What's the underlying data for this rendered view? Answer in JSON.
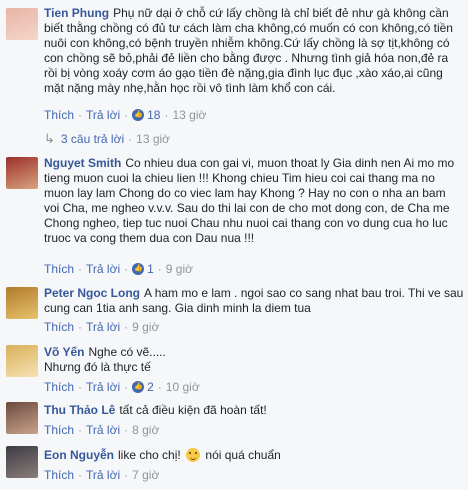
{
  "comments": [
    {
      "author": "Tien Phung",
      "text": "Phụ nữ dại ở chỗ cứ lấy chồng là chỉ biết đẻ như gà không cần biết thằng chồng có đủ tư cách làm cha không,có muốn có con không,có tiền nuôi con không,có bệnh truyền nhiễm không.Cứ lấy chồng là sợ tịt,không có con chồng sẽ bỏ,phải đẻ liền cho bằng được . Nhưng tình giả hóa non,đẻ ra rồi bị vòng xoáy cơm áo gạo tiền đè nặng,gia đình lục đục ,xào xáo,ai cũng mặt nặng mày nhẹ,hằn học rồi vô tình làm khổ con cái.",
      "like": "Thích",
      "reply": "Trả lời",
      "likes": "18",
      "time": "13 giờ",
      "replies": "3 câu trả lời",
      "avatar_colors": [
        "#e8b3a6",
        "#f3d7c9"
      ]
    },
    {
      "author": "Nguyet Smith",
      "text": "Co nhieu dua con gai vi, muon thoat ly Gia dinh nen Ai mo mo tieng muon cuoi la chieu lien !!! Khong chieu Tim hieu coi cai thang ma no muon lay lam Chong do co viec lam hay Khong ? Hay no con o nha an bam voi Cha, me ngheo v.v.v. Sau do thi lai con de cho mot dong con, de Cha me Chong ngheo, tiep tuc nuoi Chau nhu nuoi cai thang con vo dung cua ho luc truoc va cong them dua con Dau nua !!!",
      "like": "Thích",
      "reply": "Trả lời",
      "likes": "1",
      "time": "9 giờ",
      "avatar_colors": [
        "#9c2f2a",
        "#d8a47f"
      ]
    },
    {
      "author": "Peter Ngoc Long",
      "text": "A ham mo e lam . ngoi sao co sang nhat bau troi. Thi ve sau cung can 1tia anh sang. Gia dinh minh la diem tua",
      "like": "Thích",
      "reply": "Trả lời",
      "time": "9 giờ",
      "avatar_colors": [
        "#b07a2e",
        "#e7c36a"
      ]
    },
    {
      "author": "Võ Yến",
      "text": "Nghe có vẽ.....\nNhưng đó là thực tế",
      "like": "Thích",
      "reply": "Trả lời",
      "likes": "2",
      "time": "10 giờ",
      "avatar_colors": [
        "#d9b05a",
        "#f4e2b5"
      ]
    },
    {
      "author": "Thu Thảo Lê",
      "text": "tất cả điều kiện đã hoàn tất!",
      "like": "Thích",
      "reply": "Trả lời",
      "time": "8 giờ",
      "avatar_colors": [
        "#6b4b3e",
        "#c9a28c"
      ]
    },
    {
      "author": "Eon Nguyễn",
      "text_before": "like cho chị!",
      "emoji": "smile-emoji",
      "text_after": "nói quá chuẩn",
      "like": "Thích",
      "reply": "Trả lời",
      "time": "7 giờ",
      "avatar_colors": [
        "#3d3a45",
        "#8a7f7a"
      ]
    }
  ]
}
